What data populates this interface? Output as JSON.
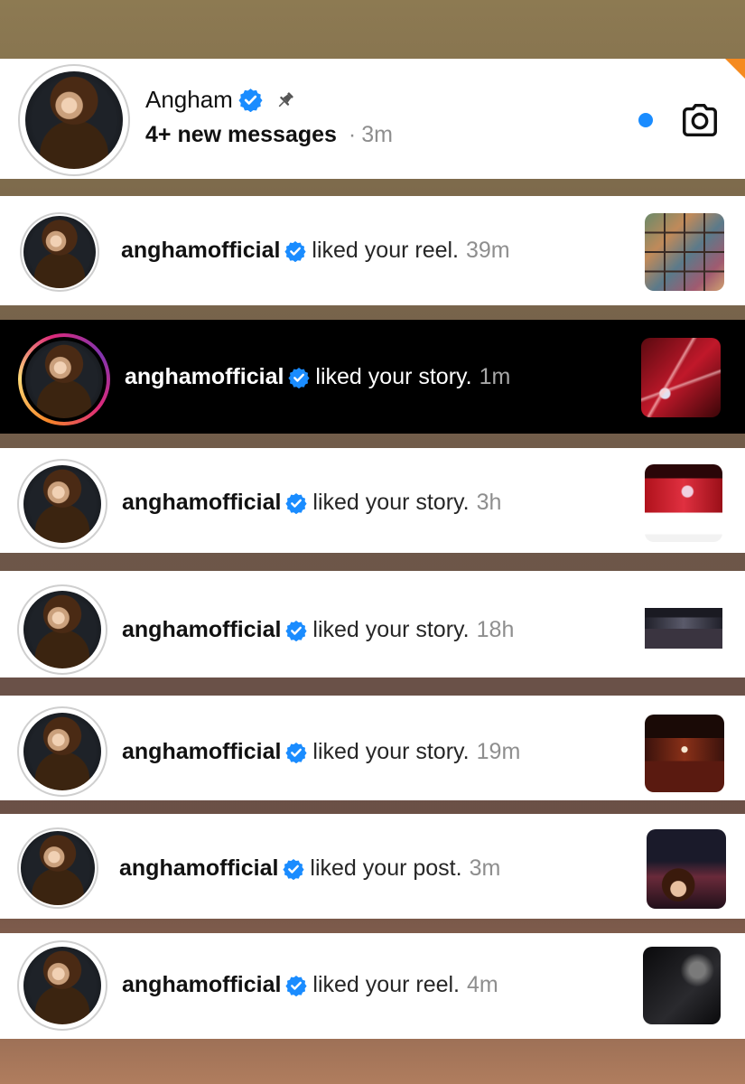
{
  "colors": {
    "accent_blue": "#1a8cff",
    "verified_blue": "#1a8cff",
    "time_gray": "#8e8e8e",
    "ribbon_orange": "#f58a1f"
  },
  "thread": {
    "name": "Angham",
    "verified_icon": "verified-badge-icon",
    "pin_icon": "pin-icon",
    "preview": "4+ new messages",
    "separator": "·",
    "time": "3m",
    "unread_indicator": "blue-dot",
    "camera_icon": "camera-icon"
  },
  "notifications": [
    {
      "username": "anghamofficial",
      "action": "liked your reel.",
      "time": "39m",
      "thumbnail": "reel-collage"
    },
    {
      "username": "anghamofficial",
      "action": "liked your story.",
      "time": "1m",
      "thumbnail": "concert-red-lights",
      "story_ring": true,
      "theme": "dark"
    },
    {
      "username": "anghamofficial",
      "action": "liked your story.",
      "time": "3h",
      "thumbnail": "stage-news"
    },
    {
      "username": "anghamofficial",
      "action": "liked your story.",
      "time": "18h",
      "thumbnail": "crowd-news"
    },
    {
      "username": "anghamofficial",
      "action": "liked your story.",
      "time": "19m",
      "thumbnail": "concert-hall"
    },
    {
      "username": "anghamofficial",
      "action": "liked your post.",
      "time": "3m",
      "thumbnail": "post-portrait"
    },
    {
      "username": "anghamofficial",
      "action": "liked your reel.",
      "time": "4m",
      "thumbnail": "reel-dark"
    }
  ]
}
